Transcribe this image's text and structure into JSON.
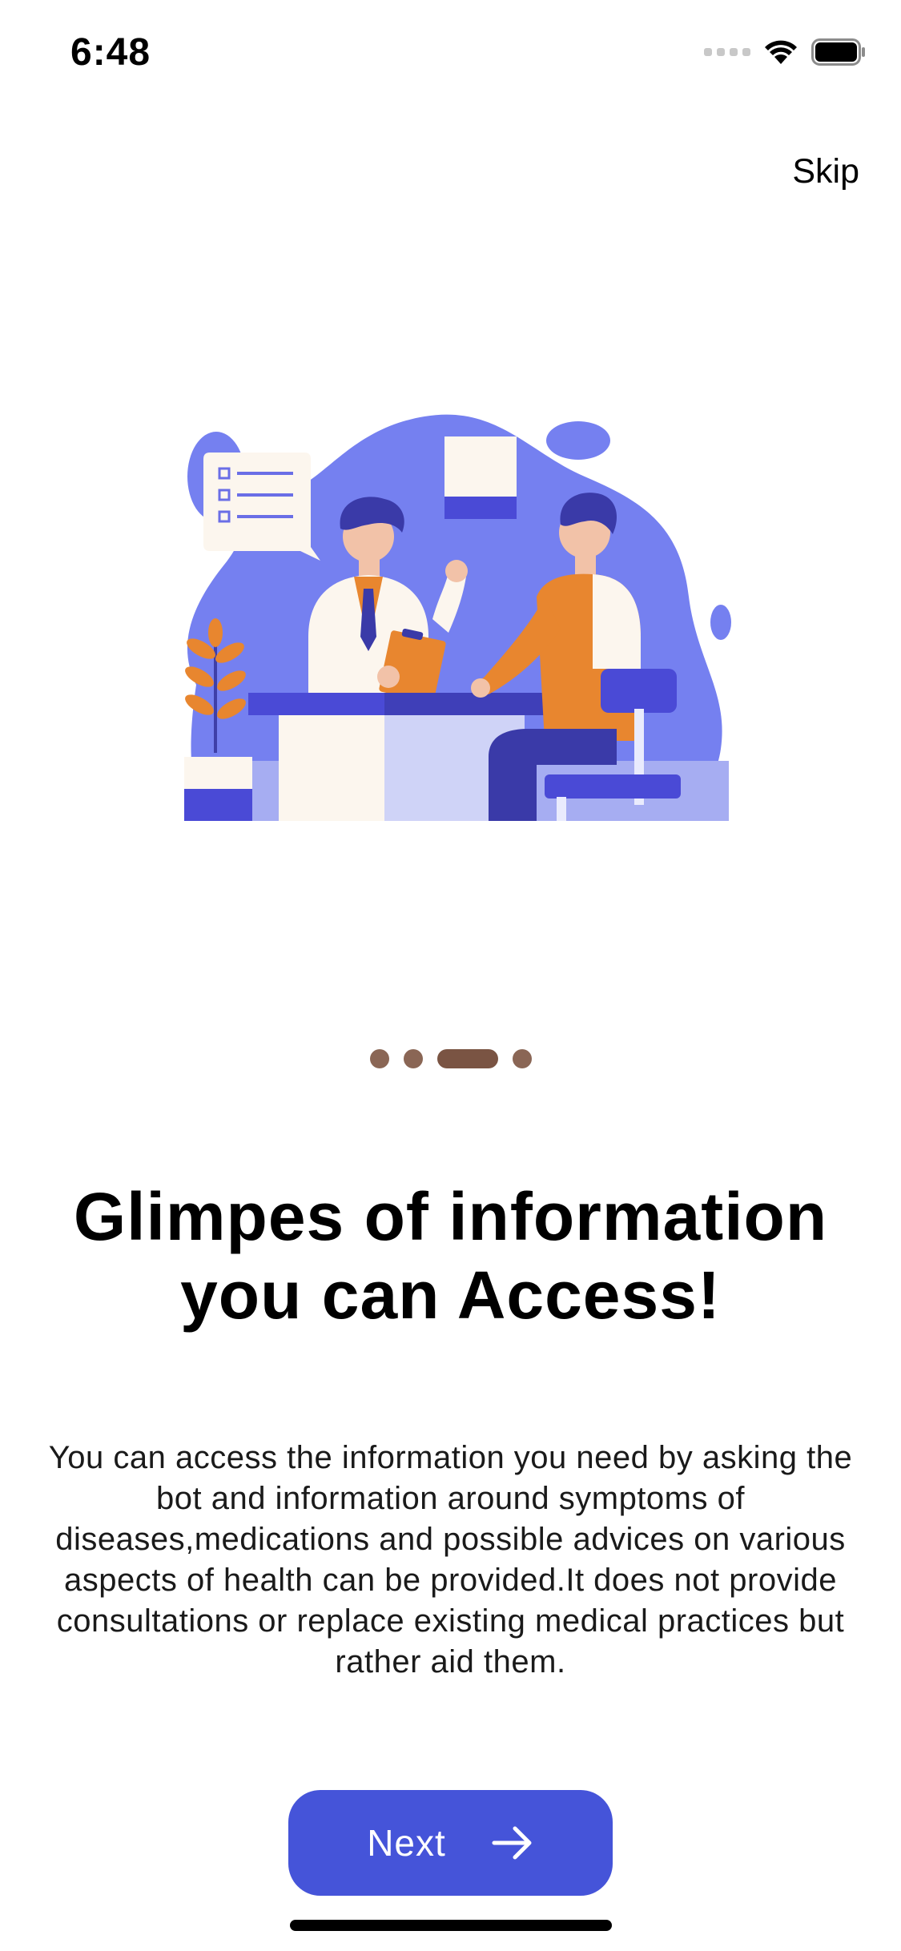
{
  "status_bar": {
    "time": "6:48",
    "signal_icon": "cellular-signal-icon",
    "wifi_icon": "wifi-icon",
    "battery_icon": "battery-icon"
  },
  "skip_label": "Skip",
  "illustration": {
    "icon": "doctor-consultation-illustration",
    "colors": {
      "blob": "#7580f0",
      "accent_blue": "#4a4ad6",
      "orange": "#e8862f",
      "cream": "#fcf6ee"
    }
  },
  "pagination": {
    "total": 4,
    "active_index": 2,
    "dot_color": "#8a6655"
  },
  "heading": {
    "line1": "Glimpes of information",
    "line2": "you can Access!"
  },
  "description": "You can access the information you need by asking the bot and information around symptoms of diseases,medications and possible advices on various aspects of health can be provided.It does not provide consultations or replace existing medical practices but rather aid them.",
  "next_button": {
    "label": "Next",
    "icon": "arrow-right-icon",
    "color": "#4554d9"
  }
}
